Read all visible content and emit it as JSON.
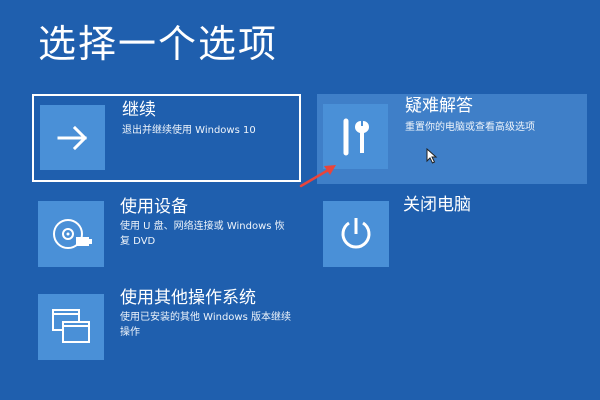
{
  "title": "选择一个选项",
  "options": [
    {
      "title": "继续",
      "desc": "退出并继续使用 Windows 10",
      "icon": "arrow-right-icon"
    },
    {
      "title": "疑难解答",
      "desc": "重置你的电脑或查看高级选项",
      "icon": "tools-icon"
    },
    {
      "title": "使用设备",
      "desc": "使用 U 盘、网络连接或 Windows 恢复 DVD",
      "icon": "disc-usb-icon"
    },
    {
      "title": "关闭电脑",
      "desc": "",
      "icon": "power-icon"
    },
    {
      "title": "使用其他操作系统",
      "desc": "使用已安装的其他 Windows 版本继续操作",
      "icon": "windows-stack-icon"
    }
  ],
  "colors": {
    "background": "#1f5fae",
    "tile": "#4a90d7",
    "highlight": "#3f7fc8",
    "annotation": "#e8453c"
  }
}
